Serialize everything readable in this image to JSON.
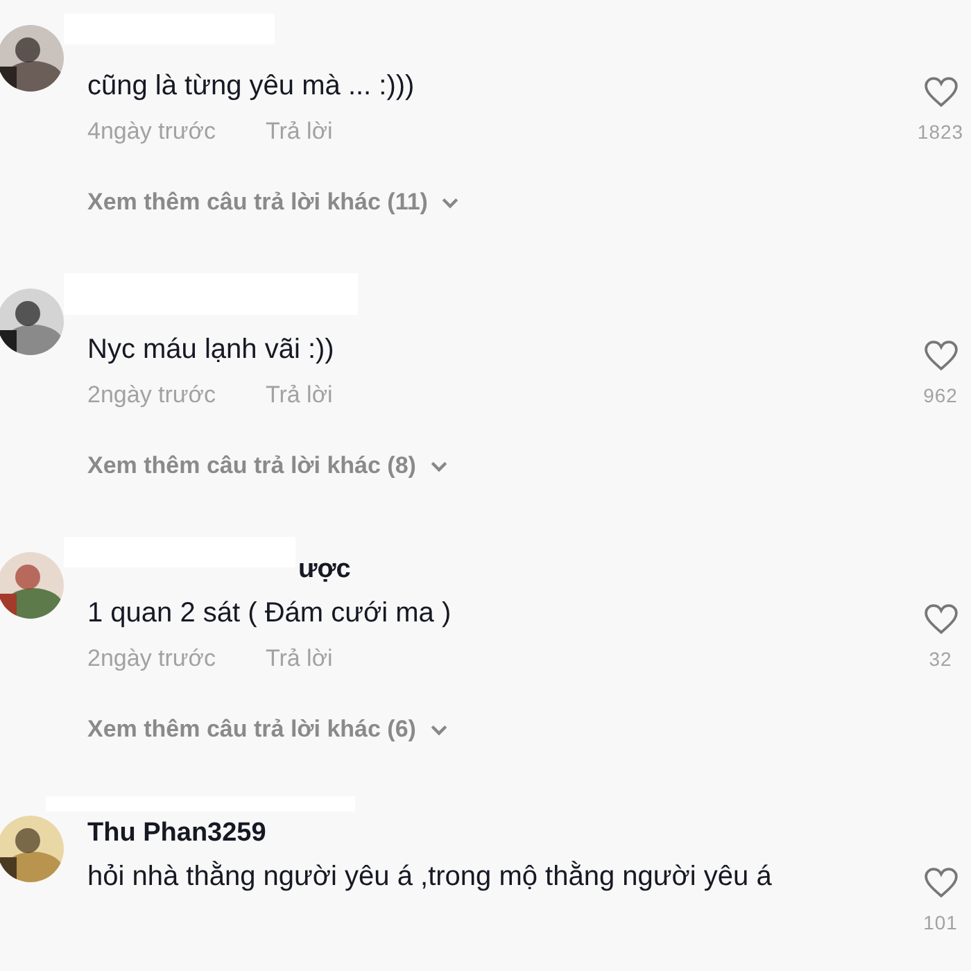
{
  "comments": [
    {
      "text": "cũng là từng yêu mà ... :)))",
      "time": "4ngày trước",
      "reply": "Trả lời",
      "likes": "1823",
      "more_replies": "Xem thêm câu trả lời khác (11)"
    },
    {
      "text": "Nyc máu lạnh vãi :))",
      "time": "2ngày trước",
      "reply": "Trả lời",
      "likes": "962",
      "more_replies": "Xem thêm câu trả lời khác (8)"
    },
    {
      "name": "ược",
      "text": "1 quan 2 sát ( Đám cưới ma )",
      "time": "2ngày trước",
      "reply": "Trả lời",
      "likes": "32",
      "more_replies": "Xem thêm câu trả lời khác (6)"
    },
    {
      "name": "Thu Phan3259",
      "text": "hỏi nhà thằng người yêu á ,trong mộ thằng người yêu á",
      "likes": "101"
    }
  ]
}
